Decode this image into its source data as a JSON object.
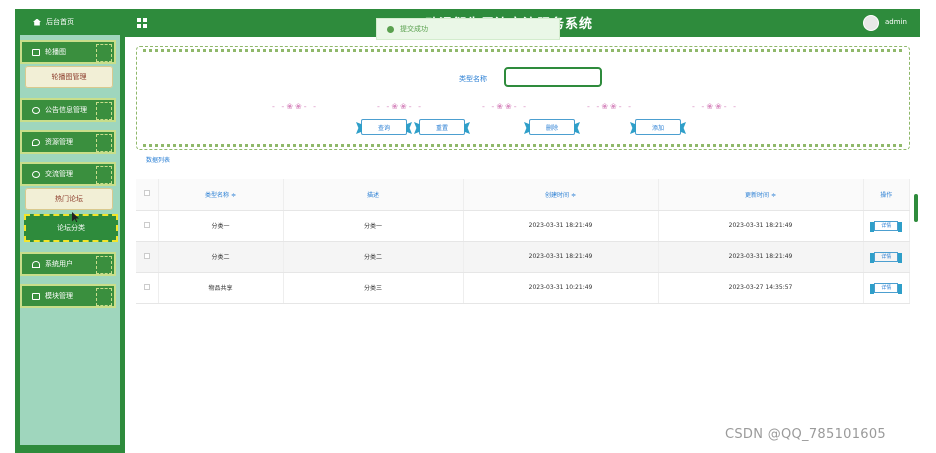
{
  "header": {
    "home_label": "后台首页",
    "title": "动漫衍生周边交流服务系统",
    "user": "admin"
  },
  "toast": {
    "message": "提交成功"
  },
  "sidebar": {
    "items": [
      {
        "label": "轮播图"
      },
      {
        "label": "轮播图管理",
        "sub": true
      },
      {
        "label": "公告信息管理"
      },
      {
        "label": "资源管理"
      },
      {
        "label": "交流管理"
      },
      {
        "label": "热门论坛",
        "sub": true
      },
      {
        "label": "论坛分类",
        "active": true
      },
      {
        "label": "系统用户"
      },
      {
        "label": "模块管理"
      }
    ]
  },
  "search": {
    "type_label": "类型名称",
    "input_value": ""
  },
  "buttons": {
    "query": "查询",
    "reset": "重置",
    "delete": "删除",
    "add": "添加"
  },
  "list_caption": "数据列表",
  "table": {
    "headers": [
      "类型名称 ≑",
      "描述",
      "创建时间 ≑",
      "更新时间 ≑",
      "操作"
    ],
    "rows": [
      {
        "name": "分类一",
        "desc": "分类一",
        "created": "2023-03-31 18:21:49",
        "updated": "2023-03-31 18:21:49",
        "action": "详情"
      },
      {
        "name": "分类二",
        "desc": "分类二",
        "created": "2023-03-31 18:21:49",
        "updated": "2023-03-31 18:21:49",
        "action": "详情"
      },
      {
        "name": "物品共享",
        "desc": "分类三",
        "created": "2023-03-31 10:21:49",
        "updated": "2023-03-27 14:35:57",
        "action": "详情"
      }
    ]
  },
  "watermark": "CSDN @QQ_785101605",
  "colors": {
    "primary_green": "#2e8b3c",
    "sidebar_light": "#9fd6bd",
    "link_blue": "#2a7fd4",
    "active_border": "#f2e52a"
  }
}
